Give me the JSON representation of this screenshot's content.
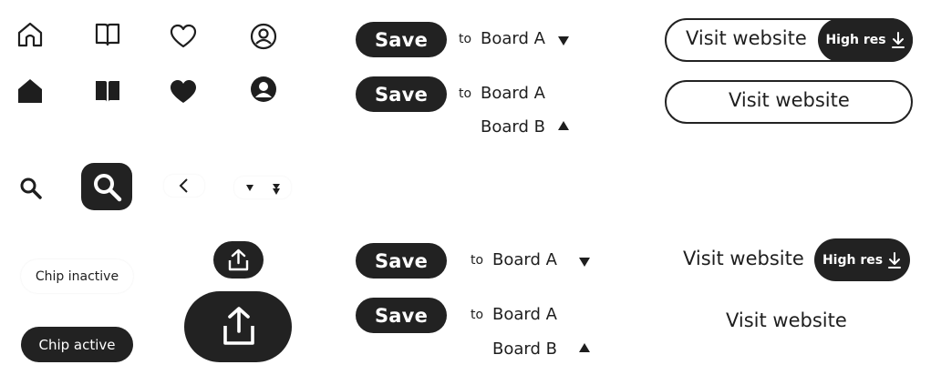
{
  "colors": {
    "primary": "#222222",
    "on_primary": "#ffffff",
    "background": "#ffffff"
  },
  "icons_outline": [
    "home-icon",
    "book-icon",
    "heart-icon",
    "user-circle-icon"
  ],
  "icons_filled": [
    "home-filled-icon",
    "book-filled-icon",
    "heart-filled-icon",
    "user-circle-filled-icon"
  ],
  "search_icons": [
    "search-icon",
    "search-large-icon"
  ],
  "nav_icons": [
    "chevron-left-icon",
    "caret-down-icon",
    "caret-down-double-icon"
  ],
  "chips": {
    "inactive_label": "Chip inactive",
    "active_label": "Chip active"
  },
  "share_icons": [
    "share-upload-icon",
    "share-upload-large-icon"
  ],
  "save_rows": [
    {
      "save_label": "Save",
      "to_label": "to",
      "board_label": "Board A",
      "caret": "down"
    },
    {
      "save_label": "Save",
      "to_label": "to",
      "board_label": "Board A",
      "extra_board_label": "Board B",
      "caret": "up"
    },
    {
      "save_label": "Save",
      "to_label": "to",
      "board_label": "Board A",
      "caret": "down"
    },
    {
      "save_label": "Save",
      "to_label": "to",
      "board_label": "Board A",
      "extra_board_label": "Board B",
      "caret": "up"
    }
  ],
  "visit": {
    "label": "Visit website",
    "hires_label": "High res"
  }
}
